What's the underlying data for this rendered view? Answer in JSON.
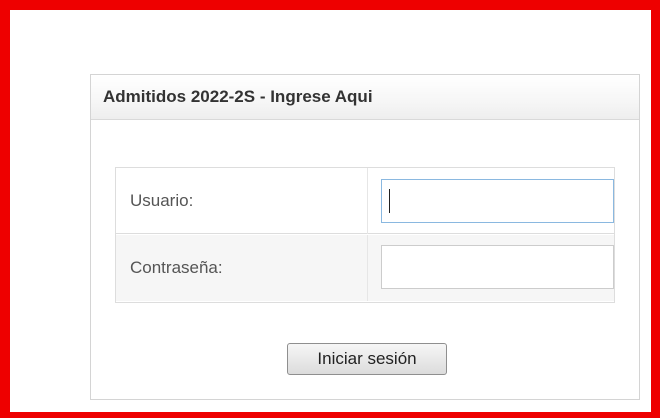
{
  "login_panel": {
    "title": "Admitidos 2022-2S - Ingrese Aqui",
    "username_label": "Usuario:",
    "username_value": "",
    "password_label": "Contraseña:",
    "password_value": "",
    "submit_label": "Iniciar sesión"
  },
  "colors": {
    "frame_border": "#ee0000",
    "focused_input_border": "#8ab8e0"
  }
}
